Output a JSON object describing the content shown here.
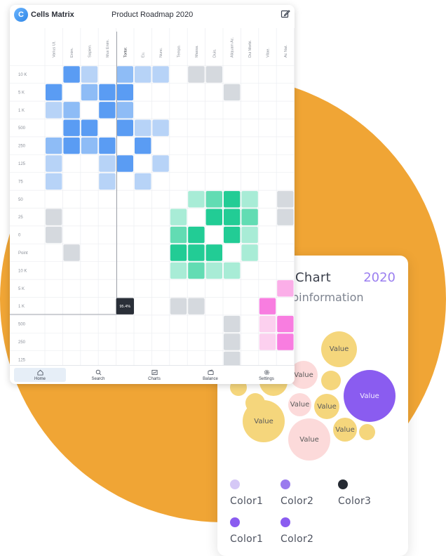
{
  "app": {
    "logo_letter": "C",
    "name": "Cells Matrix",
    "title": "Product Roadmap 2020"
  },
  "matrix": {
    "columns": [
      "Varius Ut.",
      "Enim.",
      "Sapien.",
      "Mus Enim.",
      "Tortor.",
      "Eu.",
      "Nunc.",
      "Tempo.",
      "Massa.",
      "Duis.",
      "Aliquam Ac.",
      "Dui Morbi.",
      "Vitae.",
      "Ac Nat."
    ],
    "rows": [
      "10 K",
      "5 K",
      "1 K",
      "500",
      "250",
      "125",
      "75",
      "50",
      "25",
      "0",
      "Point",
      "10 K",
      "5 K",
      "1 K",
      "500",
      "250",
      "125"
    ],
    "highlighted_row_label": "1 K",
    "highlighted_column": "Tortor.",
    "marker_value": "95.4%",
    "colors": {
      "blue": [
        "#b7d3f7",
        "#8ebcf6",
        "#5a9cf3"
      ],
      "green": [
        "#a8ecd6",
        "#62dcb3",
        "#22cc95"
      ],
      "gray": "#d5d9de",
      "pink": [
        "#fcd0ef",
        "#fbaee8",
        "#f87de0"
      ]
    },
    "cells": [
      [
        1,
        "b",
        2
      ],
      [
        2,
        "b",
        0
      ],
      [
        4,
        "b",
        1
      ],
      [
        5,
        "b",
        0
      ],
      [
        6,
        "b",
        0
      ],
      [
        8,
        "g0",
        0
      ],
      [
        9,
        "g0",
        0
      ],
      [
        0,
        "b",
        2
      ],
      [
        2,
        "b",
        1
      ],
      [
        3,
        "b",
        2
      ],
      [
        4,
        "b",
        2
      ],
      [
        10,
        "g0",
        0
      ],
      [
        0,
        "b",
        0
      ],
      [
        1,
        "b",
        1
      ],
      [
        3,
        "b",
        2
      ],
      [
        4,
        "b",
        1
      ],
      [
        1,
        "b",
        2
      ],
      [
        2,
        "b",
        2
      ],
      [
        4,
        "b",
        2
      ],
      [
        5,
        "b",
        0
      ],
      [
        6,
        "b",
        0
      ],
      [
        0,
        "b",
        1
      ],
      [
        1,
        "b",
        2
      ],
      [
        2,
        "b",
        1
      ],
      [
        3,
        "b",
        2
      ],
      [
        5,
        "b",
        2
      ],
      [
        0,
        "b",
        0
      ],
      [
        3,
        "b",
        0
      ],
      [
        4,
        "b",
        2
      ],
      [
        6,
        "b",
        0
      ],
      [
        0,
        "b",
        0
      ],
      [
        3,
        "b",
        0
      ],
      [
        5,
        "b",
        0
      ]
    ]
  },
  "tabs": [
    {
      "label": "Home",
      "icon": "home-icon"
    },
    {
      "label": "Search",
      "icon": "search-icon"
    },
    {
      "label": "Charts",
      "icon": "chart-icon"
    },
    {
      "label": "Balance",
      "icon": "wallet-icon"
    },
    {
      "label": "Settings",
      "icon": "gear-icon"
    }
  ],
  "chart_card": {
    "title": "Chart",
    "year": "2020",
    "subtitle": "binformation",
    "bubble_label": "Value",
    "legend": [
      {
        "label": "Color1",
        "color": "#d5c8f6"
      },
      {
        "label": "Color2",
        "color": "#9a7bee"
      },
      {
        "label": "Color3",
        "color": "#262b33"
      },
      {
        "label": "Color1",
        "color": "#8a5cf0"
      },
      {
        "label": "Color2",
        "color": "#8a5cf0"
      }
    ]
  }
}
